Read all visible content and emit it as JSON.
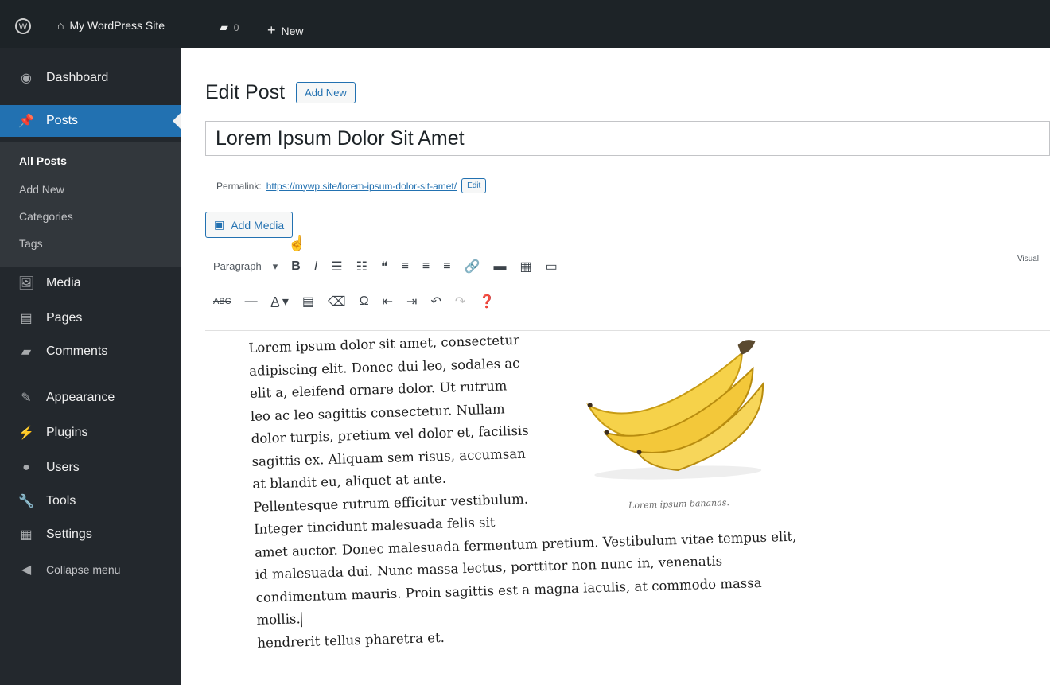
{
  "admin_bar": {
    "site_name": "My WordPress Site",
    "comments_count": "0",
    "new_label": "New"
  },
  "sidebar": {
    "items": [
      {
        "label": "Dashboard",
        "icon": "dashboard-icon",
        "glyph": "◉"
      },
      {
        "label": "Posts",
        "icon": "thumbtack-icon",
        "glyph": "📌"
      },
      {
        "label": "Media",
        "icon": "media-icon",
        "glyph": "🖼"
      },
      {
        "label": "Pages",
        "icon": "pages-icon",
        "glyph": "▤"
      },
      {
        "label": "Comments",
        "icon": "comment-icon",
        "glyph": "▰"
      },
      {
        "label": "Appearance",
        "icon": "brush-icon",
        "glyph": "✎"
      },
      {
        "label": "Plugins",
        "icon": "plug-icon",
        "glyph": "⚡"
      },
      {
        "label": "Users",
        "icon": "user-icon",
        "glyph": "●"
      },
      {
        "label": "Tools",
        "icon": "wrench-icon",
        "glyph": "🔧"
      },
      {
        "label": "Settings",
        "icon": "settings-icon",
        "glyph": "▦"
      },
      {
        "label": "Collapse menu",
        "icon": "collapse-icon",
        "glyph": "◀"
      }
    ],
    "submenu": [
      "All Posts",
      "Add New",
      "Categories",
      "Tags"
    ]
  },
  "editor": {
    "page_title": "Edit Post",
    "add_new_label": "Add New",
    "post_title": "Lorem Ipsum Dolor Sit Amet",
    "permalink_label": "Permalink:",
    "permalink_url": "https://mywp.site/lorem-ipsum-dolor-sit-amet/",
    "permalink_edit": "Edit",
    "add_media_label": "Add Media",
    "format_select": "Paragraph",
    "visual_tab": "Visual",
    "body_text": "Lorem ipsum dolor sit amet, consectetur adipiscing elit. Donec dui leo, sodales ac elit a, eleifend ornare dolor. Ut rutrum leo ac leo sagittis consectetur. Nullam dolor turpis, pretium vel dolor et, facilisis sagittis ex. Aliquam sem risus, accumsan at blandit eu, aliquet at ante. Pellentesque rutrum efficitur vestibulum. Integer tincidunt malesuada felis sit amet auctor. Donec malesuada fermentum pretium. Vestibulum vitae tempus elit, id malesuada dui. Nunc massa lectus, porttitor non nunc in, venenatis condimentum mauris. Proin sagittis est a magna iaculis, at commodo massa mollis.",
    "image_caption": "Lorem ipsum bananas.",
    "last_line_visible": "hendrerit tellus pharetra et."
  },
  "colors": {
    "admin_dark": "#1d2327",
    "sidebar": "#23282d",
    "accent": "#2271b1",
    "banana": "#f4c430"
  }
}
